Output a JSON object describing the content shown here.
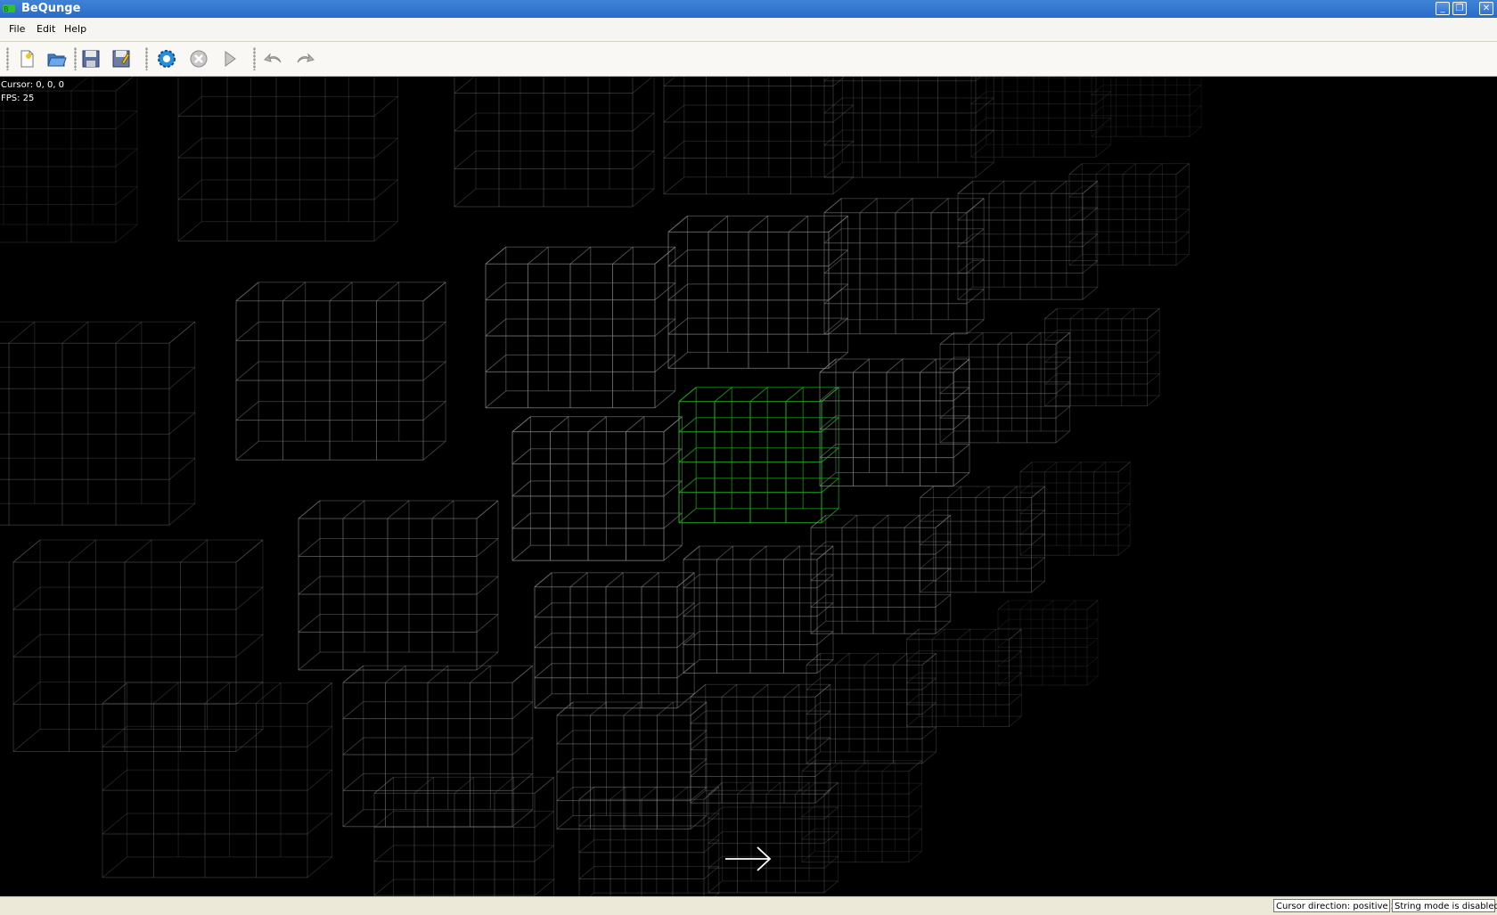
{
  "window": {
    "title": "BeQunge",
    "controls": {
      "minimize": "minimize-icon",
      "restore": "restore-icon",
      "close": "close-icon"
    }
  },
  "menu": [
    "File",
    "Edit",
    "Help"
  ],
  "toolbar": {
    "buttons": [
      {
        "name": "new-file-button",
        "icon": "new-file-icon"
      },
      {
        "name": "open-file-button",
        "icon": "open-folder-icon"
      },
      {
        "name": "save-button",
        "icon": "floppy-disk-icon"
      },
      {
        "name": "save-as-button",
        "icon": "save-as-icon"
      },
      {
        "name": "step-button",
        "icon": "gear-icon"
      },
      {
        "name": "stop-button",
        "icon": "stop-icon"
      },
      {
        "name": "run-button",
        "icon": "play-icon"
      },
      {
        "name": "undo-button",
        "icon": "undo-icon"
      },
      {
        "name": "redo-button",
        "icon": "redo-icon"
      }
    ]
  },
  "viewport": {
    "cursor_label": "Cursor: 0, 0, 0",
    "fps_label": "FPS: 25",
    "highlight_color": "#22aa22",
    "grid_color": "#888888",
    "direction_indicator": "arrow-right-icon"
  },
  "status": {
    "direction": "Cursor direction: positive x",
    "string_mode": "String mode is disabled"
  }
}
